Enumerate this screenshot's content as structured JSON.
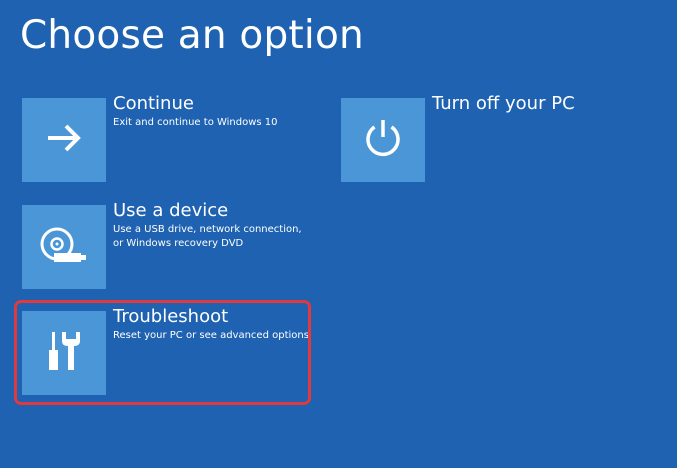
{
  "page": {
    "title": "Choose an option"
  },
  "options": [
    {
      "id": "continue",
      "title": "Continue",
      "desc": [
        "Exit and continue to Windows 10"
      ],
      "icon": "arrow-right-icon"
    },
    {
      "id": "use-device",
      "title": "Use a device",
      "desc": [
        "Use a USB drive, network connection,",
        "or Windows recovery DVD"
      ],
      "icon": "disc-drive-icon"
    },
    {
      "id": "troubleshoot",
      "title": "Troubleshoot",
      "desc": [
        "Reset your PC or see advanced options"
      ],
      "icon": "tools-icon"
    },
    {
      "id": "turn-off",
      "title": "Turn off your PC",
      "desc": [],
      "icon": "power-icon"
    }
  ],
  "colors": {
    "background": "#1e62b1",
    "tile": "#4a96d6",
    "highlight": "#e0393e"
  }
}
